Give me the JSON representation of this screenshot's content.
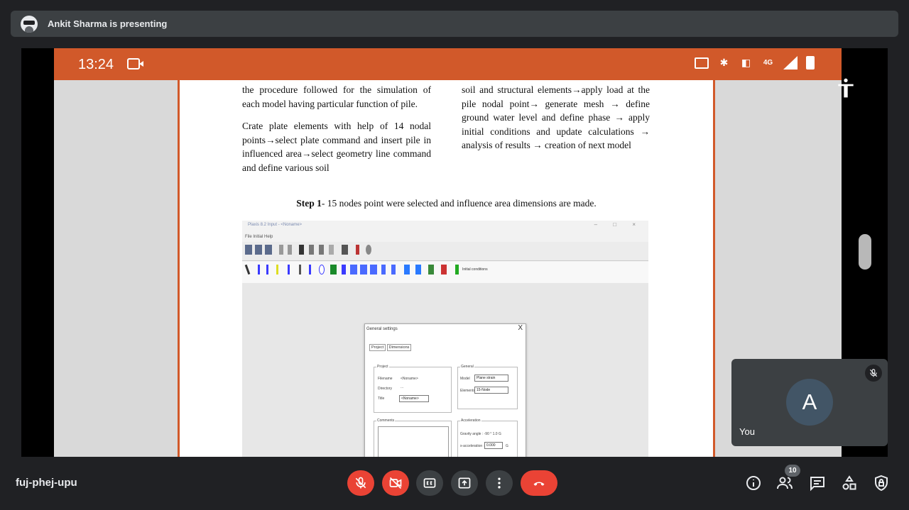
{
  "banner": {
    "presenter_text": "Ankit Sharma is presenting"
  },
  "status_bar": {
    "time": "13:24",
    "network": "4G"
  },
  "document": {
    "col1": [
      "the procedure followed for the simulation of each model having particular function of pile.",
      "Crate plate elements with help of 14 nodal points→select plate command and insert pile in influenced area→select geometry line command and define various soil"
    ],
    "col2": [
      "soil and structural elements→apply load at the pile nodal point→ generate mesh → define ground water level and define phase → apply initial conditions and update calculations → analysis of results → creation of next model"
    ],
    "step_label": "Step 1",
    "step_text": "- 15 nodes point were selected and influence area dimensions are made."
  },
  "embedded_app": {
    "title": "Plaxis 8.2 Input - <Noname>",
    "window_controls": "– □ ×",
    "menu": "File   Initial   Help",
    "toolbar_text": "Initial conditions",
    "dialog": {
      "title": "General settings",
      "close": "X",
      "tabs": [
        "Project",
        "Dimensions"
      ],
      "project_group": "Project",
      "filename_label": "Filename",
      "filename_value": "<Noname>",
      "directory_label": "Directory",
      "directory_value": "...",
      "title_label": "Title",
      "title_value": "<Noname>",
      "general_group": "General",
      "model_label": "Model",
      "model_value": "Plane strain",
      "elements_label": "Elements",
      "elements_value": "15-Node",
      "comments_group": "Comments",
      "accel_group": "Acceleration",
      "gravity_row": "Gravity angle :  -90 °    1.0   G",
      "xaccel_label": "x-acceleration :",
      "xaccel_value": "0.000",
      "xaccel_unit": "G"
    }
  },
  "self_tile": {
    "avatar_letter": "A",
    "label": "You"
  },
  "meeting": {
    "code": "fuj-phej-upu",
    "participant_count": "10"
  },
  "colors": {
    "accent_red": "#ea4335",
    "status_orange": "#d1592a",
    "bg": "#202124"
  }
}
